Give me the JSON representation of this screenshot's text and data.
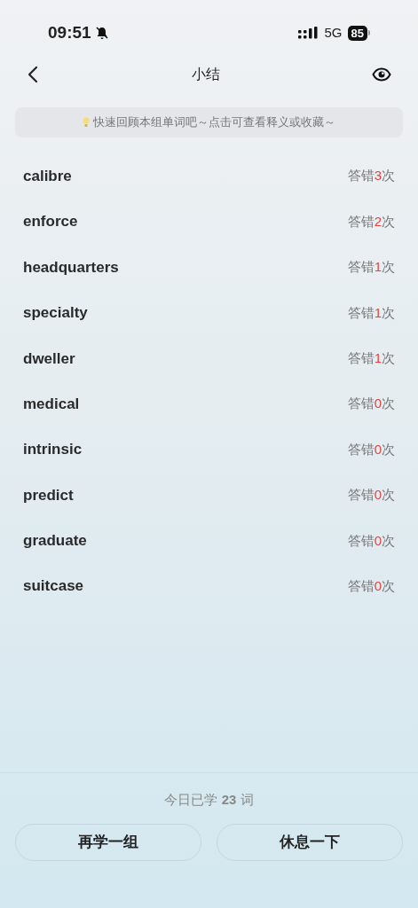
{
  "status_bar": {
    "time": "09:51",
    "network": "5G",
    "battery": "85"
  },
  "nav": {
    "title": "小结"
  },
  "tip": "快速回顾本组单词吧～点击可查看释义或收藏～",
  "words": [
    {
      "word": "calibre",
      "before": "答错",
      "count": "3",
      "after": "次"
    },
    {
      "word": "enforce",
      "before": "答错",
      "count": "2",
      "after": "次"
    },
    {
      "word": "headquarters",
      "before": "答错",
      "count": "1",
      "after": "次"
    },
    {
      "word": "specialty",
      "before": "答错",
      "count": "1",
      "after": "次"
    },
    {
      "word": "dweller",
      "before": "答错",
      "count": "1",
      "after": "次"
    },
    {
      "word": "medical",
      "before": "答错",
      "count": "0",
      "after": "次"
    },
    {
      "word": "intrinsic",
      "before": "答错",
      "count": "0",
      "after": "次"
    },
    {
      "word": "predict",
      "before": "答错",
      "count": "0",
      "after": "次"
    },
    {
      "word": "graduate",
      "before": "答错",
      "count": "0",
      "after": "次"
    },
    {
      "word": "suitcase",
      "before": "答错",
      "count": "0",
      "after": "次"
    }
  ],
  "summary": "今日已学 **23** 词",
  "buttons": [
    "再学一组",
    "休息一下"
  ]
}
